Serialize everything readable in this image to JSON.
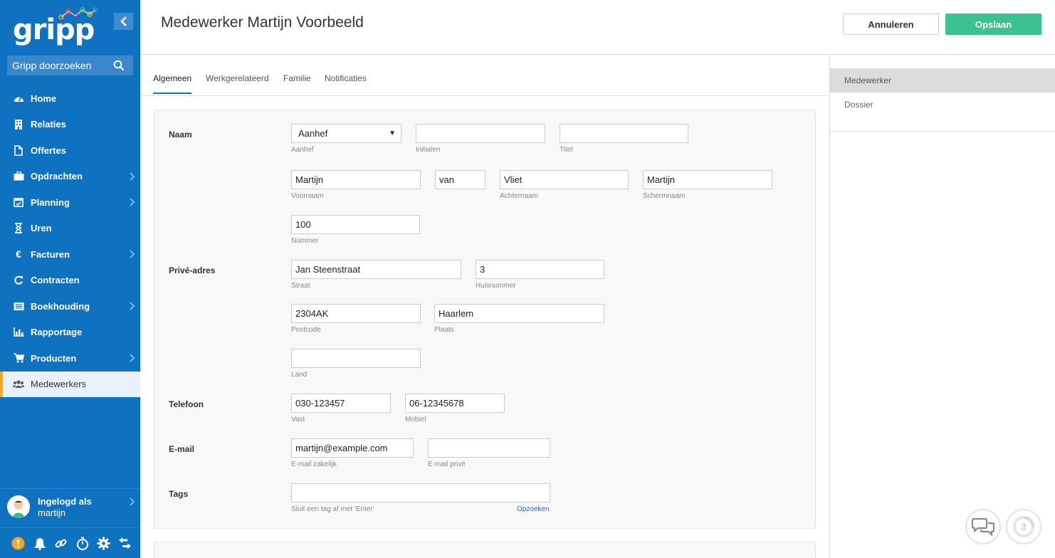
{
  "app": {
    "logo": "gripp",
    "search_placeholder": "Gripp doorzoeken"
  },
  "sidebar": {
    "items": [
      {
        "label": "Home",
        "icon": "dashboard-icon",
        "chevron": false
      },
      {
        "label": "Relaties",
        "icon": "building-icon",
        "chevron": false
      },
      {
        "label": "Offertes",
        "icon": "document-icon",
        "chevron": false
      },
      {
        "label": "Opdrachten",
        "icon": "briefcase-icon",
        "chevron": true
      },
      {
        "label": "Planning",
        "icon": "calendar-icon",
        "chevron": true
      },
      {
        "label": "Uren",
        "icon": "hourglass-icon",
        "chevron": false
      },
      {
        "label": "Facturen",
        "icon": "euro-icon",
        "chevron": true
      },
      {
        "label": "Contracten",
        "icon": "refresh-icon",
        "chevron": false
      },
      {
        "label": "Boekhouding",
        "icon": "ledger-icon",
        "chevron": true
      },
      {
        "label": "Rapportage",
        "icon": "bar-chart-icon",
        "chevron": false
      },
      {
        "label": "Producten",
        "icon": "cart-icon",
        "chevron": true
      },
      {
        "label": "Medewerkers",
        "icon": "users-icon",
        "chevron": false,
        "active": true
      }
    ],
    "user_line1": "Ingelogd als",
    "user_line2": "martijn"
  },
  "header": {
    "title": "Medewerker Martijn Voorbeeld",
    "cancel_label": "Annuleren",
    "save_label": "Opslaan"
  },
  "tabs": [
    "Algemeen",
    "Werkgerelateerd",
    "Familie",
    "Notificaties"
  ],
  "right_panel": {
    "items": [
      "Medewerker",
      "Dossier"
    ]
  },
  "form": {
    "naam_label": "Naam",
    "aanhef": {
      "value": "Aanhef",
      "label": "Aanhef"
    },
    "initialen": {
      "value": "",
      "label": "Initialen"
    },
    "titel": {
      "value": "",
      "label": "Titel"
    },
    "voornaam": {
      "value": "Martijn",
      "label": "Voornaam"
    },
    "tussenvoegsel": {
      "value": "van"
    },
    "achternaam": {
      "value": "Vliet",
      "label": "Achternaam"
    },
    "schermnaam": {
      "value": "Martijn",
      "label": "Schermnaam"
    },
    "nummer": {
      "value": "100",
      "label": "Nummer"
    },
    "adres_label": "Privé-adres",
    "straat": {
      "value": "Jan Steenstraat",
      "label": "Straat"
    },
    "huisnummer": {
      "value": "3",
      "label": "Huisnummer"
    },
    "postcode": {
      "value": "2304AK",
      "label": "Postcode"
    },
    "plaats": {
      "value": "Haarlem",
      "label": "Plaats"
    },
    "land": {
      "value": "",
      "label": "Land"
    },
    "telefoon_label": "Telefoon",
    "vast": {
      "value": "030-123457",
      "label": "Vast"
    },
    "mobiel": {
      "value": "06-12345678",
      "label": "Mobiel"
    },
    "email_label": "E-mail",
    "email_zakelijk": {
      "value": "martijn@example.com",
      "label": "E-mail zakelijk"
    },
    "email_prive": {
      "value": "",
      "label": "E-mail privé"
    },
    "tags_label": "Tags",
    "tags": {
      "value": "",
      "hint": "Sluit een tag af met 'Enter'",
      "lookup": "Opzoeken"
    }
  },
  "fab": {
    "badge": "3"
  },
  "colors": {
    "sidebar": "#0f72c0",
    "save": "#3cc28e",
    "active_marker": "#f5a623"
  }
}
